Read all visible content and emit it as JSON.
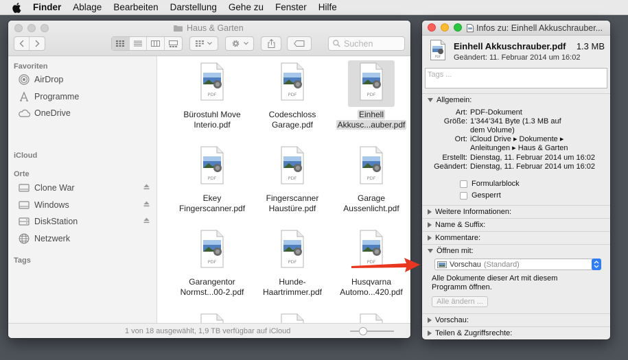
{
  "menubar": {
    "app": "Finder",
    "items": [
      "Ablage",
      "Bearbeiten",
      "Darstellung",
      "Gehe zu",
      "Fenster",
      "Hilfe"
    ]
  },
  "finder": {
    "title": "Haus & Garten",
    "search_placeholder": "Suchen",
    "sidebar": {
      "favorites_header": "Favoriten",
      "favorites": [
        "AirDrop",
        "Programme",
        "OneDrive"
      ],
      "icloud_header": "iCloud",
      "places_header": "Orte",
      "places": [
        "Clone War",
        "Windows",
        "DiskStation",
        "Netzwerk"
      ],
      "tags_header": "Tags"
    },
    "files": [
      {
        "line1": "Bürostuhl Move",
        "line2": "Interio.pdf"
      },
      {
        "line1": "Codeschloss",
        "line2": "Garage.pdf"
      },
      {
        "line1": "Einhell",
        "line2": "Akkusc...auber.pdf"
      },
      {
        "line1": "Ekey",
        "line2": "Fingerscanner.pdf"
      },
      {
        "line1": "Fingerscanner",
        "line2": "Haustüre.pdf"
      },
      {
        "line1": "Garage",
        "line2": "Aussenlicht.pdf"
      },
      {
        "line1": "Garangentor",
        "line2": "Normst...00-2.pdf"
      },
      {
        "line1": "Hunde-",
        "line2": "Haartrimmer.pdf"
      },
      {
        "line1": "Husqvarna",
        "line2": "Automo...420.pdf"
      }
    ],
    "pdf_label": "PDF",
    "status": "1 von 18 ausgewählt, 1,9 TB verfügbar auf iCloud",
    "icon_size_slider": 0.2
  },
  "info": {
    "title": "Infos zu: Einhell Akkuschrauber...",
    "file_name": "Einhell Akkuschrauber.pdf",
    "file_size": "1.3 MB",
    "modified": "Geändert: 11. Februar 2014 um 16:02",
    "tags_placeholder": "Tags ...",
    "general": {
      "header": "Allgemein:",
      "art_k": "Art:",
      "art_v": "PDF-Dokument",
      "size_k": "Größe:",
      "size_v1": "1’344’341 Byte (1.3 MB auf",
      "size_v2": "dem Volume)",
      "ort_k": "Ort:",
      "ort_v1": "iCloud Drive ▸ Dokumente ▸",
      "ort_v2": "Anleitungen ▸ Haus & Garten",
      "created_k": "Erstellt:",
      "created_v": "Dienstag, 11. Februar 2014 um 16:02",
      "changed_k": "Geändert:",
      "changed_v": "Dienstag, 11. Februar 2014 um 16:02",
      "formular": "Formularblock",
      "locked": "Gesperrt"
    },
    "more_info": "Weitere Informationen:",
    "name_ext": "Name & Suffix:",
    "comments": "Kommentare:",
    "open_with": {
      "header": "Öffnen mit:",
      "app": "Vorschau",
      "app_suffix": "(Standard)",
      "text1": "Alle Dokumente dieser Art mit diesem",
      "text2": "Programm öffnen.",
      "button": "Alle ändern ..."
    },
    "preview": "Vorschau:",
    "sharing": "Teilen & Zugriffsrechte:"
  },
  "colors": {
    "accent": "#2f7df7",
    "arrow": "#e8361f",
    "close": "#fc5d57",
    "minimize": "#fdbc2e",
    "zoom": "#27c840"
  }
}
